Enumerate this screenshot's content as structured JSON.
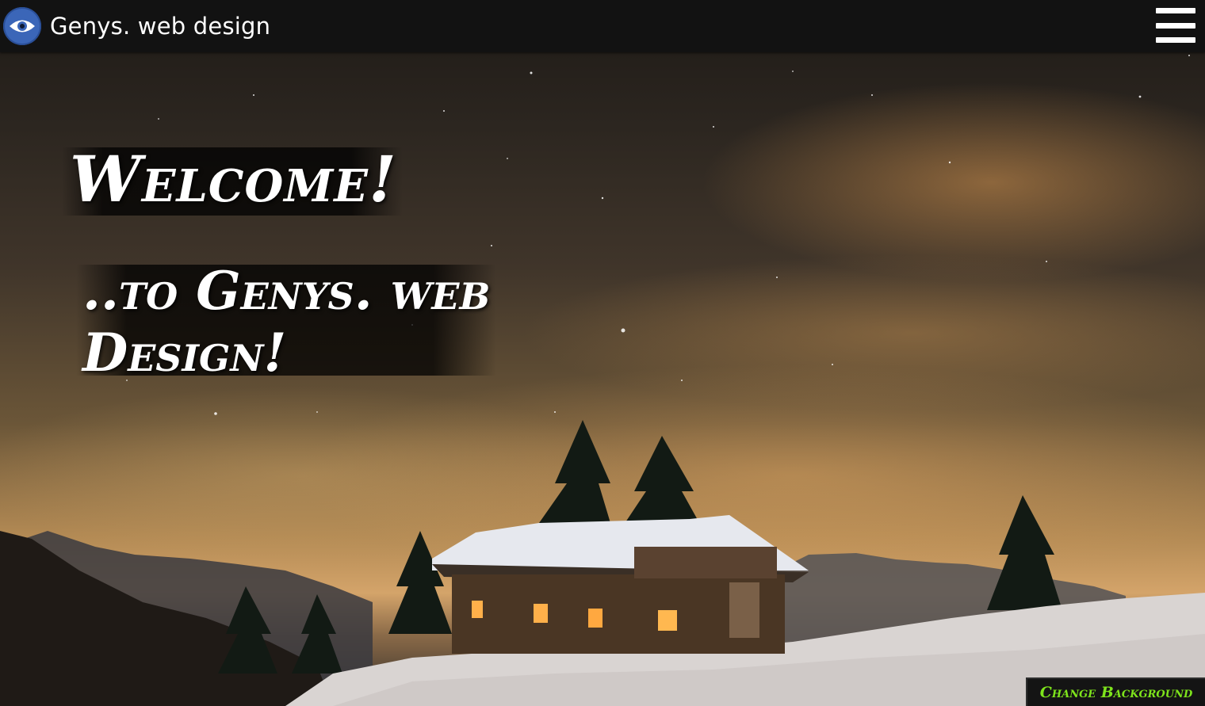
{
  "navbar": {
    "brand": "Genys. web design",
    "logo_icon": "eye-icon",
    "menu_icon": "hamburger-menu-icon"
  },
  "hero": {
    "welcome": "Welcome!",
    "subtitle": "..to Genys. web Design!"
  },
  "actions": {
    "change_background": "Change Background"
  },
  "colors": {
    "navbar_bg": "#121212",
    "logo_blue": "#3b66b8",
    "accent_green": "#7ee41c"
  }
}
